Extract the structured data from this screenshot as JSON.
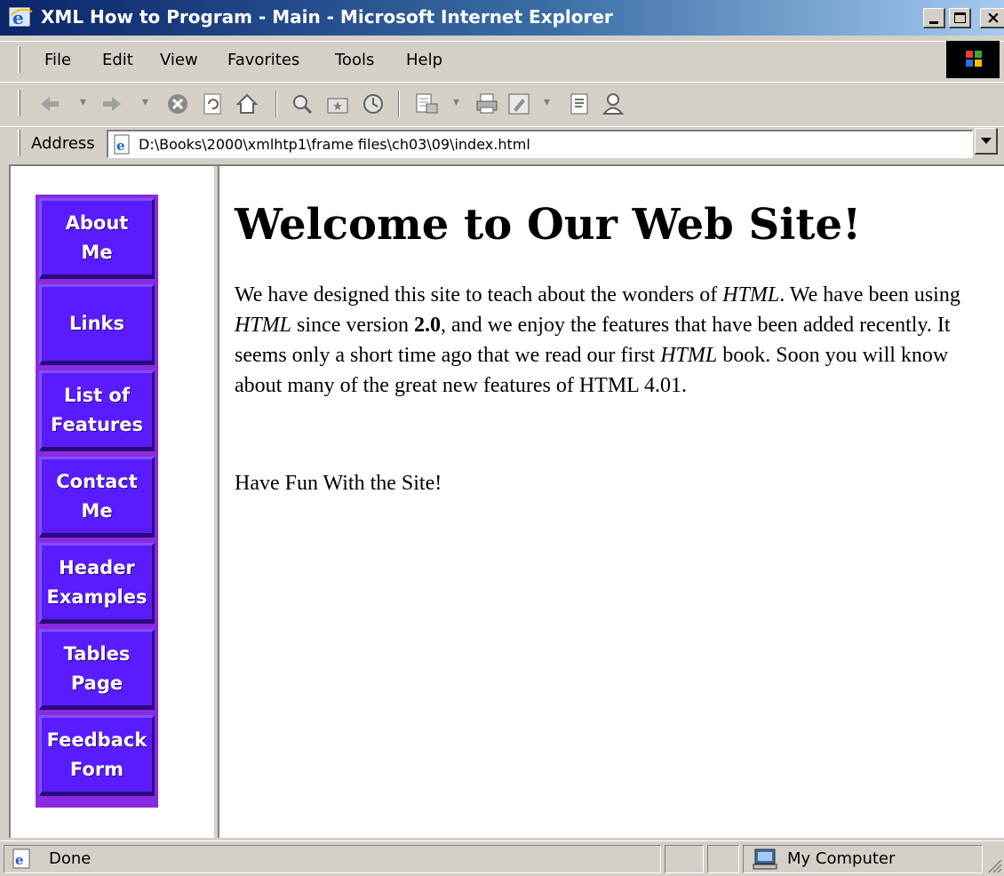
{
  "window": {
    "title": "XML How to Program - Main - Microsoft Internet Explorer"
  },
  "menu": {
    "items": [
      "File",
      "Edit",
      "View",
      "Favorites",
      "Tools",
      "Help"
    ]
  },
  "toolbar": {
    "icons": [
      "back-icon",
      "forward-icon",
      "stop-icon",
      "refresh-icon",
      "home-icon",
      "search-icon",
      "favorites-icon",
      "history-icon",
      "mail-icon",
      "print-icon",
      "edit-icon",
      "discuss-icon",
      "messenger-icon"
    ]
  },
  "address": {
    "label": "Address",
    "url": "D:\\Books\\2000\\xmlhtp1\\frame files\\ch03\\09\\index.html"
  },
  "nav": {
    "items": [
      {
        "label": "About\nMe"
      },
      {
        "label": "Links"
      },
      {
        "label": "List of\nFeatures"
      },
      {
        "label": "Contact\nMe"
      },
      {
        "label": "Header\nExamples"
      },
      {
        "label": "Tables\nPage"
      },
      {
        "label": "Feedback\nForm"
      }
    ],
    "button_color": "#5a1cff",
    "border_color": "#8a2be2"
  },
  "main": {
    "heading": "Welcome to Our Web Site!",
    "para": {
      "t1": "We have designed this site to teach about the wonders of ",
      "html1": "HTML",
      "t2": ". We have been using ",
      "html2": "HTML",
      "t3": " since version ",
      "version": "2.0",
      "t4": ", and we enjoy the features that have been added recently. It seems only a short time ago that we read our first ",
      "html3": "HTML",
      "t5": " book. Soon you will know about many of the great new features of HTML 4.01."
    },
    "closing": "Have Fun With the Site!"
  },
  "status": {
    "text": "Done",
    "zone": "My Computer"
  },
  "colors": {
    "titlebar_start": "#0a246a",
    "chrome": "#d4d0c8"
  }
}
